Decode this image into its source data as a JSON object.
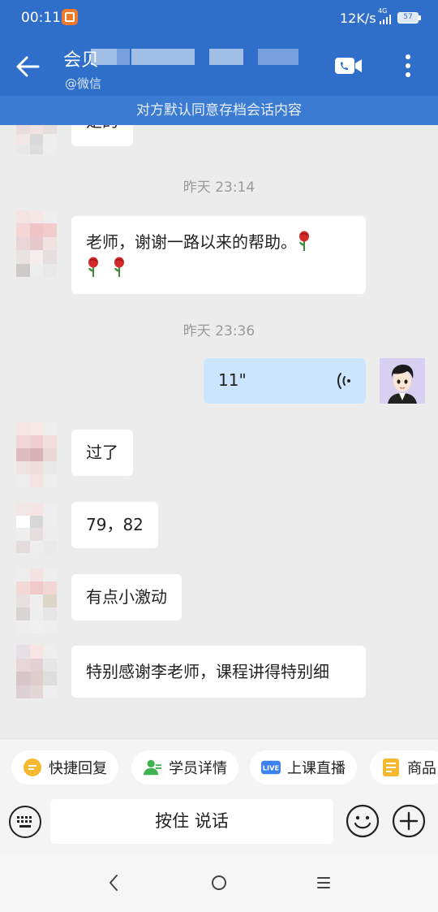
{
  "status_bar": {
    "time": "00:11",
    "speed": "12K/s",
    "network": "4G",
    "battery": "57"
  },
  "header": {
    "contact_name": "会贝",
    "contact_subtitle": "@微信",
    "icons": [
      "back-arrow-icon",
      "video-call-icon",
      "more-vertical-icon"
    ]
  },
  "archive_notice": "对方默认同意存档会话内容",
  "chat": {
    "partial_message": "是的",
    "time_1": "昨天  23:14",
    "message_thanks": "老师，谢谢一路以来的帮助。",
    "time_2": "昨天  23:36",
    "voice_duration": "11\"",
    "message_passed": "过了",
    "message_scores": "79，82",
    "message_excited": "有点小激动",
    "message_final": "特别感谢李老师，课程讲得特别细"
  },
  "quick_actions": [
    {
      "label": "快捷回复",
      "icon": "quick-reply-icon",
      "color": "#f5b82e"
    },
    {
      "label": "学员详情",
      "icon": "student-detail-icon",
      "color": "#3fb34f"
    },
    {
      "label": "上课直播",
      "icon": "live-icon",
      "color": "#3b82f0"
    },
    {
      "label": "商品",
      "icon": "goods-icon",
      "color": "#f5b82e"
    }
  ],
  "input_bar": {
    "hold_to_talk": "按住 说话"
  },
  "colors": {
    "header_blue": "#2f6fc9",
    "notice_blue": "#3c7bd2",
    "self_bubble": "#cce5ff"
  }
}
